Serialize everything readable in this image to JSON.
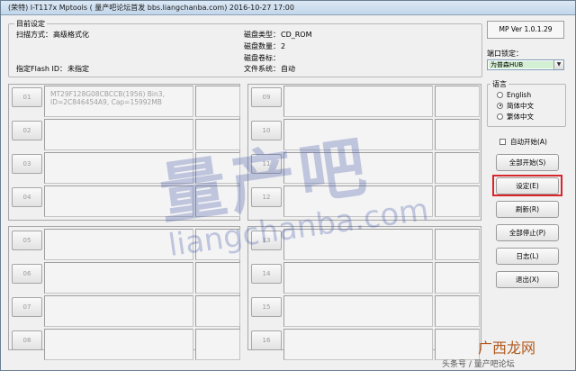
{
  "window": {
    "title": "(荣特) I-T117x Mptools ( 量产吧论坛首发 bbs.liangchanba.com)     2016-10-27 17:00"
  },
  "settings": {
    "legend": "目前设定",
    "scan_mode_label": "扫描方式：",
    "scan_mode_value": "高级格式化",
    "flash_id_label": "指定Flash ID：",
    "flash_id_value": "未指定",
    "disk_type_label": "磁盘类型：",
    "disk_type_value": "CD_ROM",
    "disk_count_label": "磁盘数量：",
    "disk_count_value": "2",
    "disk_label_label": "磁盘卷标：",
    "disk_label_value": "",
    "filesystem_label": "文件系统：",
    "filesystem_value": "自动"
  },
  "slots": [
    {
      "num": "01",
      "info_line1": "MT29F128G08CBCCB(1956) Bin3,",
      "info_line2": "ID=2C846454A9, Cap=15992MB"
    },
    {
      "num": "02",
      "info_line1": "",
      "info_line2": ""
    },
    {
      "num": "03",
      "info_line1": "",
      "info_line2": ""
    },
    {
      "num": "04",
      "info_line1": "",
      "info_line2": ""
    },
    {
      "num": "05",
      "info_line1": "",
      "info_line2": ""
    },
    {
      "num": "06",
      "info_line1": "",
      "info_line2": ""
    },
    {
      "num": "07",
      "info_line1": "",
      "info_line2": ""
    },
    {
      "num": "08",
      "info_line1": "",
      "info_line2": ""
    },
    {
      "num": "09",
      "info_line1": "",
      "info_line2": ""
    },
    {
      "num": "10",
      "info_line1": "",
      "info_line2": ""
    },
    {
      "num": "11",
      "info_line1": "",
      "info_line2": ""
    },
    {
      "num": "12",
      "info_line1": "",
      "info_line2": ""
    },
    {
      "num": "13",
      "info_line1": "",
      "info_line2": ""
    },
    {
      "num": "14",
      "info_line1": "",
      "info_line2": ""
    },
    {
      "num": "15",
      "info_line1": "",
      "info_line2": ""
    },
    {
      "num": "16",
      "info_line1": "",
      "info_line2": ""
    }
  ],
  "sidebar": {
    "version": "MP Ver 1.0.1.29",
    "port_lock_label": "端口锁定：",
    "port_lock_value": "为普森HUB",
    "language_label": "语言",
    "languages": [
      {
        "label": "English",
        "checked": false
      },
      {
        "label": "简体中文",
        "checked": true
      },
      {
        "label": "繁体中文",
        "checked": false
      }
    ],
    "auto_start_label": "自动开始(A)",
    "auto_start_checked": false,
    "buttons": {
      "start_all": "全部开始(S)",
      "settings": "设定(E)",
      "refresh": "刷新(R)",
      "stop_all": "全部停止(P)",
      "log": "日志(L)",
      "exit": "退出(X)"
    },
    "highlight_color": "#d9262c"
  },
  "watermarks": {
    "big": "量产吧",
    "url": "liangchanba.com",
    "corner_source": "头条号 / 量产吧论坛",
    "corner_site": "广西龙网"
  }
}
